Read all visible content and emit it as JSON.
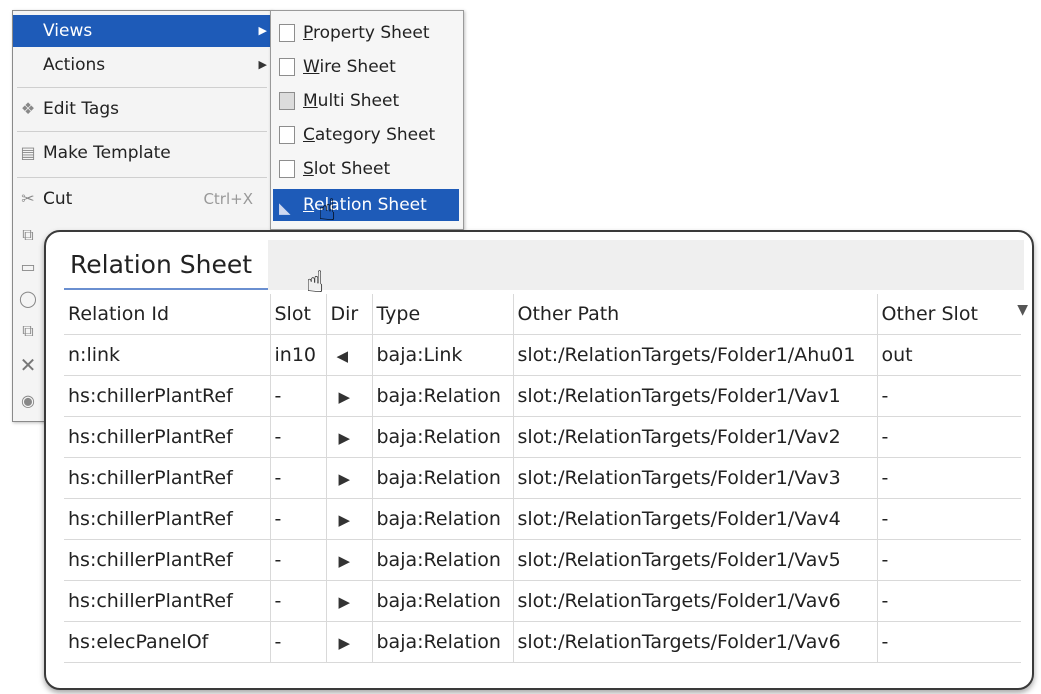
{
  "context_menu": {
    "items": [
      {
        "label": "Views",
        "icon": "",
        "submenu": true,
        "shortcut": ""
      },
      {
        "label": "Actions",
        "icon": "",
        "submenu": true,
        "shortcut": ""
      },
      {
        "label": "Edit Tags",
        "icon": "tag-icon",
        "submenu": false,
        "shortcut": ""
      },
      {
        "label": "Make Template",
        "icon": "template-icon",
        "submenu": false,
        "shortcut": ""
      },
      {
        "label": "Cut",
        "icon": "cut-icon",
        "submenu": false,
        "shortcut": "Ctrl+X"
      }
    ]
  },
  "views_submenu": {
    "items": [
      {
        "label": "Property Sheet",
        "mnemonic": "P"
      },
      {
        "label": "Wire Sheet",
        "mnemonic": "W"
      },
      {
        "label": "Multi Sheet",
        "mnemonic": "M"
      },
      {
        "label": "Category Sheet",
        "mnemonic": "C"
      },
      {
        "label": "Slot Sheet",
        "mnemonic": "S"
      },
      {
        "label": "Relation Sheet",
        "mnemonic": "R"
      }
    ]
  },
  "relation_sheet": {
    "tab_label": "Relation Sheet",
    "columns": [
      "Relation Id",
      "Slot",
      "Dir",
      "Type",
      "Other Path",
      "Other Slot"
    ],
    "rows": [
      {
        "relation_id": "n:link",
        "slot": "in10",
        "dir": "left",
        "type": "baja:Link",
        "other_path": "slot:/RelationTargets/Folder1/Ahu01",
        "other_slot": "out"
      },
      {
        "relation_id": "hs:chillerPlantRef",
        "slot": "-",
        "dir": "right",
        "type": "baja:Relation",
        "other_path": "slot:/RelationTargets/Folder1/Vav1",
        "other_slot": "-"
      },
      {
        "relation_id": "hs:chillerPlantRef",
        "slot": "-",
        "dir": "right",
        "type": "baja:Relation",
        "other_path": "slot:/RelationTargets/Folder1/Vav2",
        "other_slot": "-"
      },
      {
        "relation_id": "hs:chillerPlantRef",
        "slot": "-",
        "dir": "right",
        "type": "baja:Relation",
        "other_path": "slot:/RelationTargets/Folder1/Vav3",
        "other_slot": "-"
      },
      {
        "relation_id": "hs:chillerPlantRef",
        "slot": "-",
        "dir": "right",
        "type": "baja:Relation",
        "other_path": "slot:/RelationTargets/Folder1/Vav4",
        "other_slot": "-"
      },
      {
        "relation_id": "hs:chillerPlantRef",
        "slot": "-",
        "dir": "right",
        "type": "baja:Relation",
        "other_path": "slot:/RelationTargets/Folder1/Vav5",
        "other_slot": "-"
      },
      {
        "relation_id": "hs:chillerPlantRef",
        "slot": "-",
        "dir": "right",
        "type": "baja:Relation",
        "other_path": "slot:/RelationTargets/Folder1/Vav6",
        "other_slot": "-"
      },
      {
        "relation_id": "hs:elecPanelOf",
        "slot": "-",
        "dir": "right",
        "type": "baja:Relation",
        "other_path": "slot:/RelationTargets/Folder1/Vav6",
        "other_slot": "-"
      }
    ]
  },
  "colors": {
    "selection": "#1e5bb8",
    "tab_underline": "#6a8fd0"
  }
}
